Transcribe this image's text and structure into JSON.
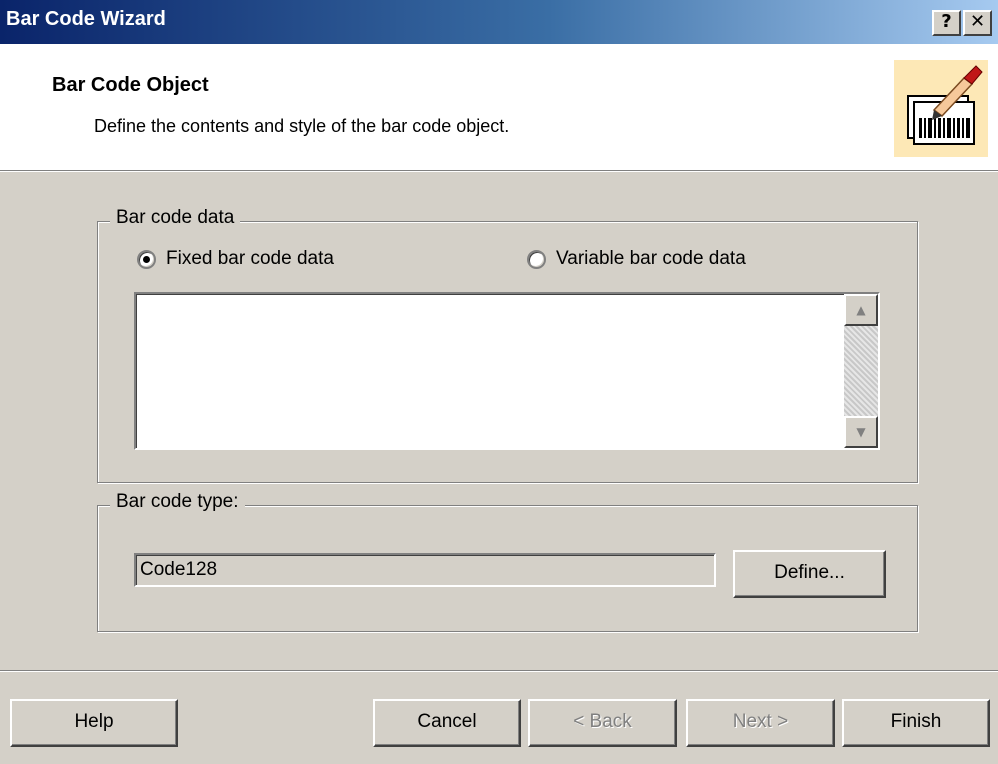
{
  "window": {
    "title": "Bar Code Wizard",
    "help_glyph": "?",
    "close_glyph": "✕"
  },
  "header": {
    "title": "Bar Code Object",
    "subtitle": "Define the contents and style of the bar code object.",
    "icon": "barcode-pen-icon"
  },
  "data_group": {
    "legend": "Bar code data",
    "fixed_label": "Fixed bar code data",
    "variable_label": "Variable bar code data",
    "selected": "fixed",
    "text_value": "",
    "scroll_up_glyph": "▲",
    "scroll_down_glyph": "▼"
  },
  "type_group": {
    "legend": "Bar code type:",
    "value": "Code128",
    "define_label": "Define..."
  },
  "footer": {
    "help_label": "Help",
    "cancel_label": "Cancel",
    "back_label": "< Back",
    "next_label": "Next >",
    "finish_label": "Finish"
  }
}
